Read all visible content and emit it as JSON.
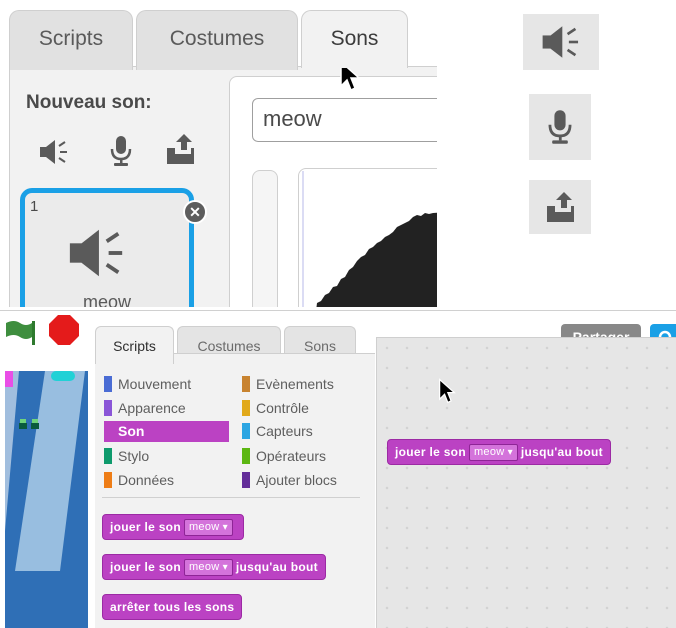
{
  "top": {
    "tabs": [
      {
        "label": "Scripts"
      },
      {
        "label": "Costumes"
      },
      {
        "label": "Sons"
      }
    ],
    "new_sound_label": "Nouveau son:",
    "new_sound_icons": [
      "speaker-icon",
      "microphone-icon",
      "upload-icon"
    ],
    "sound_item": {
      "number": "1",
      "name": "meow"
    },
    "sound_name_value": "meow"
  },
  "side_icons": [
    "speaker-icon",
    "microphone-icon",
    "upload-icon"
  ],
  "bottom": {
    "tabs": [
      {
        "label": "Scripts"
      },
      {
        "label": "Costumes"
      },
      {
        "label": "Sons"
      }
    ],
    "share_label": "Partager",
    "categories_left": [
      {
        "label": "Mouvement",
        "color": "#4a6cd4"
      },
      {
        "label": "Apparence",
        "color": "#8a55d7"
      },
      {
        "label": "Son",
        "color": "#bb42c3"
      },
      {
        "label": "Stylo",
        "color": "#0e9a6c"
      },
      {
        "label": "Données",
        "color": "#ee7d16"
      }
    ],
    "categories_right": [
      {
        "label": "Evènements",
        "color": "#c88330"
      },
      {
        "label": "Contrôle",
        "color": "#e1a91a"
      },
      {
        "label": "Capteurs",
        "color": "#2ca5e2"
      },
      {
        "label": "Opérateurs",
        "color": "#5cb712"
      },
      {
        "label": "Ajouter blocs",
        "color": "#632d99"
      }
    ],
    "selected_category": "Son",
    "blocks": {
      "play_sound": {
        "text": "jouer le son",
        "menu": "meow"
      },
      "play_until_done": {
        "text": "jouer le son",
        "menu": "meow",
        "suffix": "jusqu'au bout"
      },
      "stop_all": {
        "text": "arrêter tous les sons"
      }
    },
    "script_block": {
      "text": "jouer le son",
      "menu": "meow",
      "suffix": "jusqu'au bout"
    }
  }
}
